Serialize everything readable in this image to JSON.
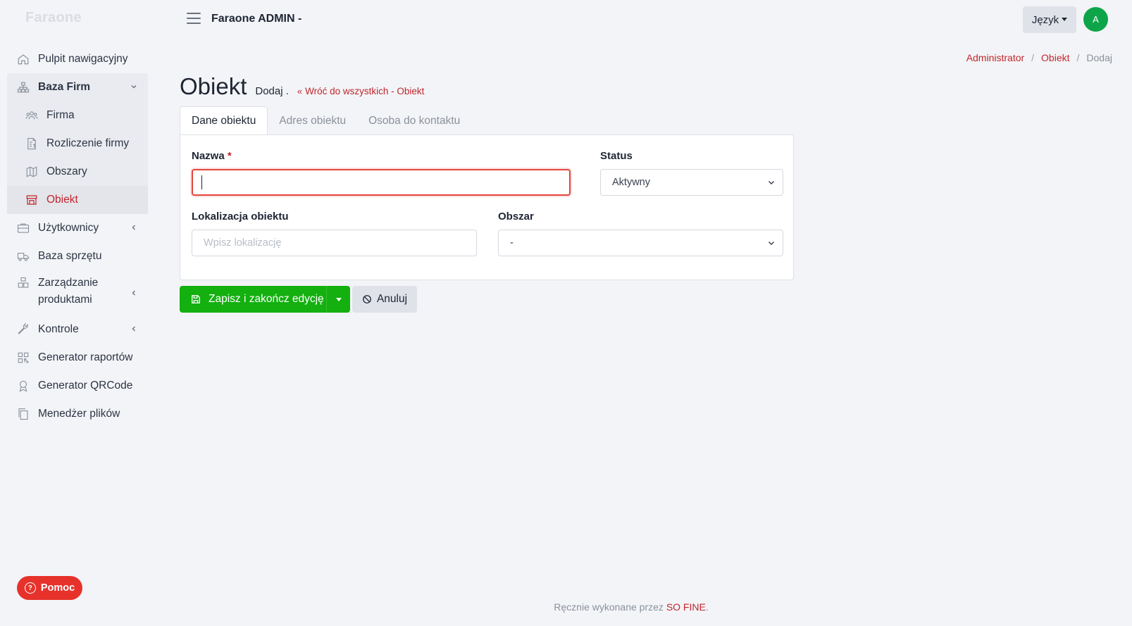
{
  "brand": "Faraone",
  "header": {
    "app_title": "Faraone ADMIN -",
    "language_label": "Język",
    "avatar_initial": "A"
  },
  "sidebar": {
    "items": [
      {
        "label": "Pulpit nawigacyjny",
        "icon": "home-icon"
      },
      {
        "label": "Baza Firm",
        "icon": "sitemap-icon",
        "expanded": true,
        "children": [
          {
            "label": "Firma",
            "icon": "users-icon"
          },
          {
            "label": "Rozliczenie firmy",
            "icon": "invoice-icon"
          },
          {
            "label": "Obszary",
            "icon": "map-icon"
          },
          {
            "label": "Obiekt",
            "icon": "building-icon",
            "active": true
          }
        ]
      },
      {
        "label": "Użytkownicy",
        "icon": "briefcase-icon"
      },
      {
        "label": "Baza sprzętu",
        "icon": "truck-icon"
      },
      {
        "label": "Zarządzanie produktami",
        "icon": "boxes-icon"
      },
      {
        "label": "Kontrole",
        "icon": "wrench-icon"
      },
      {
        "label": "Generator raportów",
        "icon": "qrcode-icon"
      },
      {
        "label": "Generator QRCode",
        "icon": "award-icon"
      },
      {
        "label": "Menedżer plików",
        "icon": "files-icon"
      }
    ],
    "help_label": "Pomoc"
  },
  "breadcrumb": [
    "Administrator",
    "Obiekt",
    "Dodaj"
  ],
  "page": {
    "title": "Obiekt",
    "subtitle": "Dodaj .",
    "back_link": "Wróć do wszystkich - Obiekt"
  },
  "tabs": [
    {
      "label": "Dane obiektu",
      "active": true
    },
    {
      "label": "Adres obiektu",
      "active": false
    },
    {
      "label": "Osoba do kontaktu",
      "active": false
    }
  ],
  "form": {
    "name": {
      "label": "Nazwa",
      "required_mark": "*",
      "value": ""
    },
    "status": {
      "label": "Status",
      "value": "Aktywny"
    },
    "location": {
      "label": "Lokalizacja obiektu",
      "placeholder": "Wpisz lokalizację",
      "value": ""
    },
    "area": {
      "label": "Obszar",
      "value": "-"
    }
  },
  "actions": {
    "save_label": "Zapisz i zakończ edycję",
    "cancel_label": "Anuluj"
  },
  "footer": {
    "prefix": "Ręcznie wykonane przez",
    "brand": "SO FINE",
    "suffix": "."
  },
  "colors": {
    "accent": "#c0262c",
    "success": "#13b00f",
    "help": "#e6322b",
    "avatar": "#0ea54a"
  }
}
